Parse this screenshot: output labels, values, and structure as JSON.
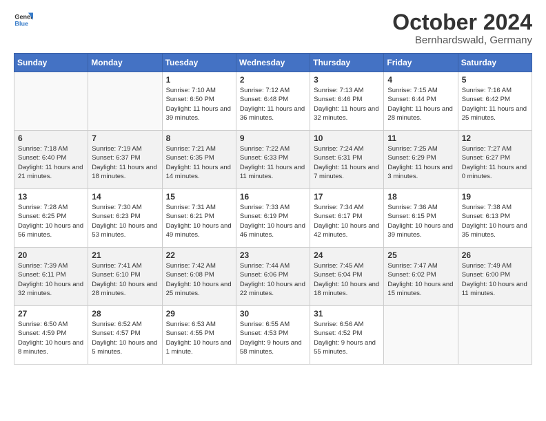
{
  "header": {
    "title": "October 2024",
    "location": "Bernhardswald, Germany"
  },
  "calendar": {
    "days": [
      "Sunday",
      "Monday",
      "Tuesday",
      "Wednesday",
      "Thursday",
      "Friday",
      "Saturday"
    ]
  },
  "weeks": [
    [
      {
        "day": "",
        "content": ""
      },
      {
        "day": "",
        "content": ""
      },
      {
        "day": "1",
        "content": "Sunrise: 7:10 AM\nSunset: 6:50 PM\nDaylight: 11 hours and 39 minutes."
      },
      {
        "day": "2",
        "content": "Sunrise: 7:12 AM\nSunset: 6:48 PM\nDaylight: 11 hours and 36 minutes."
      },
      {
        "day": "3",
        "content": "Sunrise: 7:13 AM\nSunset: 6:46 PM\nDaylight: 11 hours and 32 minutes."
      },
      {
        "day": "4",
        "content": "Sunrise: 7:15 AM\nSunset: 6:44 PM\nDaylight: 11 hours and 28 minutes."
      },
      {
        "day": "5",
        "content": "Sunrise: 7:16 AM\nSunset: 6:42 PM\nDaylight: 11 hours and 25 minutes."
      }
    ],
    [
      {
        "day": "6",
        "content": "Sunrise: 7:18 AM\nSunset: 6:40 PM\nDaylight: 11 hours and 21 minutes."
      },
      {
        "day": "7",
        "content": "Sunrise: 7:19 AM\nSunset: 6:37 PM\nDaylight: 11 hours and 18 minutes."
      },
      {
        "day": "8",
        "content": "Sunrise: 7:21 AM\nSunset: 6:35 PM\nDaylight: 11 hours and 14 minutes."
      },
      {
        "day": "9",
        "content": "Sunrise: 7:22 AM\nSunset: 6:33 PM\nDaylight: 11 hours and 11 minutes."
      },
      {
        "day": "10",
        "content": "Sunrise: 7:24 AM\nSunset: 6:31 PM\nDaylight: 11 hours and 7 minutes."
      },
      {
        "day": "11",
        "content": "Sunrise: 7:25 AM\nSunset: 6:29 PM\nDaylight: 11 hours and 3 minutes."
      },
      {
        "day": "12",
        "content": "Sunrise: 7:27 AM\nSunset: 6:27 PM\nDaylight: 11 hours and 0 minutes."
      }
    ],
    [
      {
        "day": "13",
        "content": "Sunrise: 7:28 AM\nSunset: 6:25 PM\nDaylight: 10 hours and 56 minutes."
      },
      {
        "day": "14",
        "content": "Sunrise: 7:30 AM\nSunset: 6:23 PM\nDaylight: 10 hours and 53 minutes."
      },
      {
        "day": "15",
        "content": "Sunrise: 7:31 AM\nSunset: 6:21 PM\nDaylight: 10 hours and 49 minutes."
      },
      {
        "day": "16",
        "content": "Sunrise: 7:33 AM\nSunset: 6:19 PM\nDaylight: 10 hours and 46 minutes."
      },
      {
        "day": "17",
        "content": "Sunrise: 7:34 AM\nSunset: 6:17 PM\nDaylight: 10 hours and 42 minutes."
      },
      {
        "day": "18",
        "content": "Sunrise: 7:36 AM\nSunset: 6:15 PM\nDaylight: 10 hours and 39 minutes."
      },
      {
        "day": "19",
        "content": "Sunrise: 7:38 AM\nSunset: 6:13 PM\nDaylight: 10 hours and 35 minutes."
      }
    ],
    [
      {
        "day": "20",
        "content": "Sunrise: 7:39 AM\nSunset: 6:11 PM\nDaylight: 10 hours and 32 minutes."
      },
      {
        "day": "21",
        "content": "Sunrise: 7:41 AM\nSunset: 6:10 PM\nDaylight: 10 hours and 28 minutes."
      },
      {
        "day": "22",
        "content": "Sunrise: 7:42 AM\nSunset: 6:08 PM\nDaylight: 10 hours and 25 minutes."
      },
      {
        "day": "23",
        "content": "Sunrise: 7:44 AM\nSunset: 6:06 PM\nDaylight: 10 hours and 22 minutes."
      },
      {
        "day": "24",
        "content": "Sunrise: 7:45 AM\nSunset: 6:04 PM\nDaylight: 10 hours and 18 minutes."
      },
      {
        "day": "25",
        "content": "Sunrise: 7:47 AM\nSunset: 6:02 PM\nDaylight: 10 hours and 15 minutes."
      },
      {
        "day": "26",
        "content": "Sunrise: 7:49 AM\nSunset: 6:00 PM\nDaylight: 10 hours and 11 minutes."
      }
    ],
    [
      {
        "day": "27",
        "content": "Sunrise: 6:50 AM\nSunset: 4:59 PM\nDaylight: 10 hours and 8 minutes."
      },
      {
        "day": "28",
        "content": "Sunrise: 6:52 AM\nSunset: 4:57 PM\nDaylight: 10 hours and 5 minutes."
      },
      {
        "day": "29",
        "content": "Sunrise: 6:53 AM\nSunset: 4:55 PM\nDaylight: 10 hours and 1 minute."
      },
      {
        "day": "30",
        "content": "Sunrise: 6:55 AM\nSunset: 4:53 PM\nDaylight: 9 hours and 58 minutes."
      },
      {
        "day": "31",
        "content": "Sunrise: 6:56 AM\nSunset: 4:52 PM\nDaylight: 9 hours and 55 minutes."
      },
      {
        "day": "",
        "content": ""
      },
      {
        "day": "",
        "content": ""
      }
    ]
  ]
}
